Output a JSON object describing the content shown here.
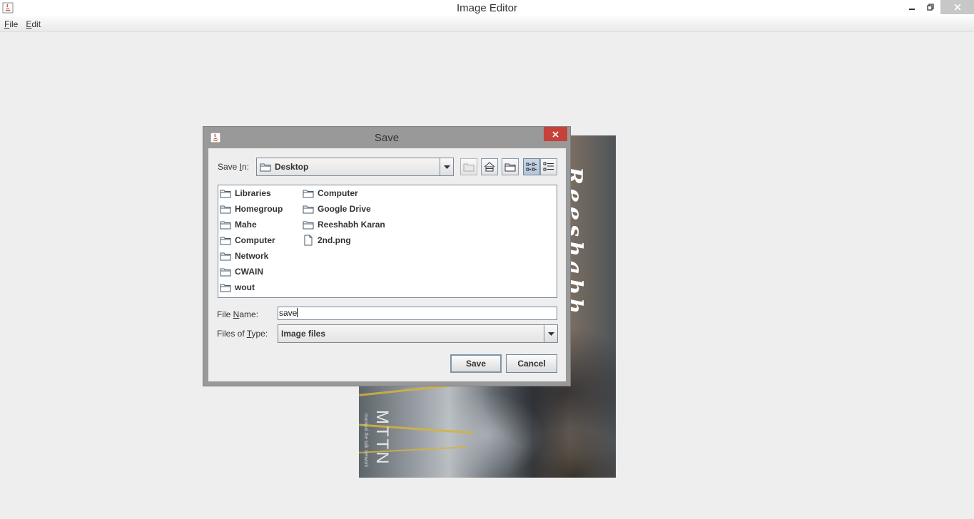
{
  "window": {
    "title": "Image Editor"
  },
  "menubar": {
    "file": {
      "mnemonic": "F",
      "rest": "ile"
    },
    "edit": {
      "mnemonic": "E",
      "rest": "dit"
    }
  },
  "canvas": {
    "vertical_text_name": "Reeshabh",
    "vertical_text_brand": "MTTN",
    "vertical_text_sub": "manipal the talk network"
  },
  "dialog": {
    "title": "Save",
    "save_in": {
      "label_pre": "Save ",
      "label_mnemonic": "I",
      "label_post": "n:",
      "value": "Desktop"
    },
    "files_col1": [
      "Libraries",
      "Homegroup",
      "Mahe",
      "Computer",
      "Network",
      "CWAIN",
      "wout"
    ],
    "files_col2": [
      {
        "name": "Computer",
        "type": "folder"
      },
      {
        "name": "Google Drive",
        "type": "folder"
      },
      {
        "name": "Reeshabh Karan",
        "type": "folder"
      },
      {
        "name": "2nd.png",
        "type": "file"
      }
    ],
    "file_name": {
      "label_pre": "File ",
      "label_mnemonic": "N",
      "label_post": "ame:",
      "value": "save"
    },
    "files_of_type": {
      "label_pre": "Files of ",
      "label_mnemonic": "T",
      "label_post": "ype:",
      "value": "Image files"
    },
    "save_button": "Save",
    "cancel_button": "Cancel"
  },
  "colors": {
    "dialog_close": "#c7403a",
    "window_close": "#c7c7c7",
    "accent_border": "#7a8a99"
  }
}
